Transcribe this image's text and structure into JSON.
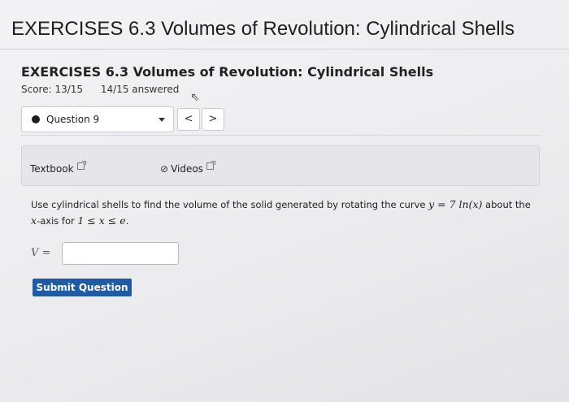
{
  "page": {
    "title": "EXERCISES 6.3 Volumes of Revolution: Cylindrical Shells"
  },
  "assignment": {
    "title": "EXERCISES 6.3 Volumes of Revolution: Cylindrical Shells",
    "score": "Score: 13/15",
    "answered": "14/15 answered"
  },
  "question_nav": {
    "selected": "Question 9",
    "prev_label": "<",
    "next_label": ">"
  },
  "resources": {
    "textbook": "Textbook",
    "videos": "Videos"
  },
  "problem": {
    "text_1": "Use cylindrical shells to find the volume of the solid generated by rotating the curve ",
    "math_1": "y = 7 ln(x)",
    "text_2": " about the",
    "math_2": "x",
    "text_3": "-axis for ",
    "math_3": "1 ≤ x ≤ e",
    "text_4": "."
  },
  "answer": {
    "label": "V =",
    "value": ""
  },
  "submit": {
    "label": "Submit Question"
  }
}
